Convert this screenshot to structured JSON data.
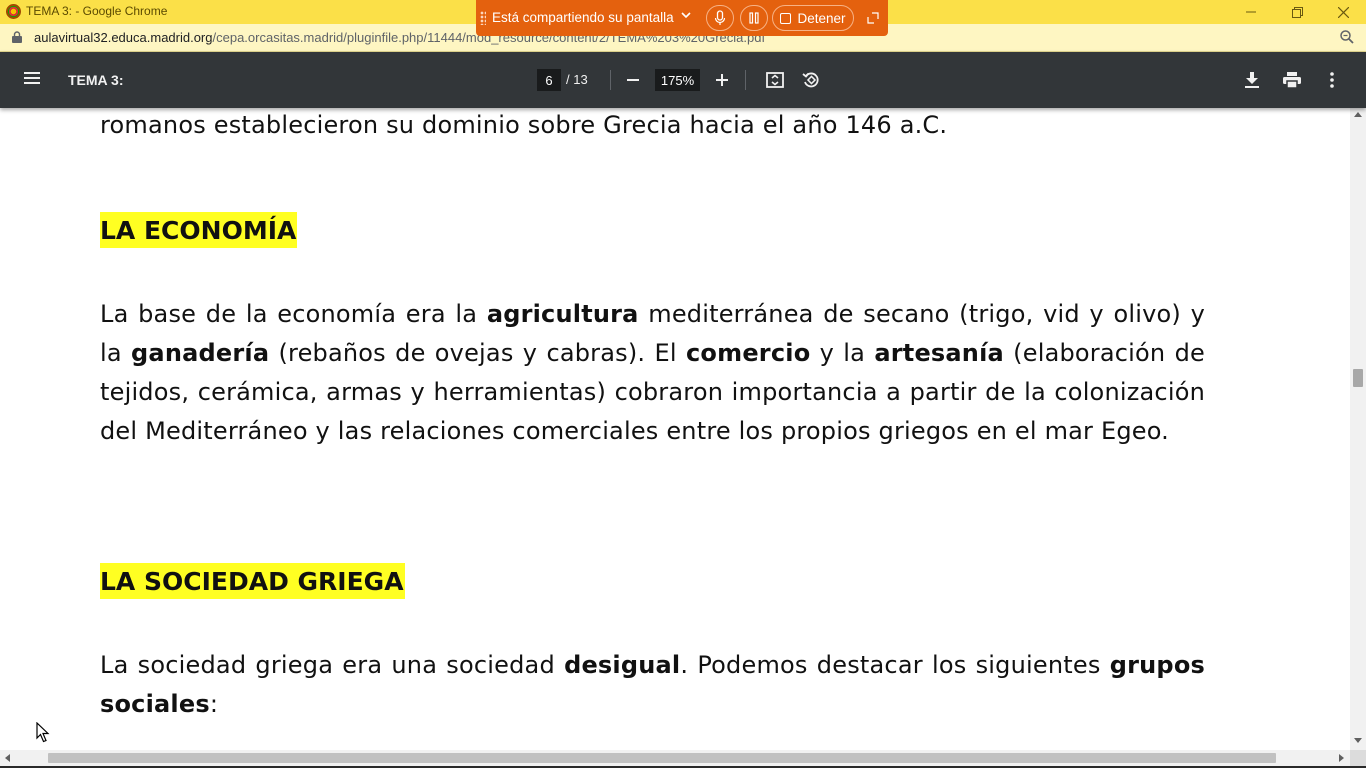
{
  "window": {
    "title": "TEMA 3: - Google Chrome",
    "minimize_icon": "minimize-icon",
    "restore_icon": "restore-icon",
    "close_icon": "close-icon",
    "title_bar_color": "#fbe048"
  },
  "share_banner": {
    "text": "Está compartiendo su pantalla",
    "stop_label": "Detener",
    "color": "#e4610e"
  },
  "address_bar": {
    "host": "aulavirtual32.educa.madrid.org",
    "path": "/cepa.orcasitas.madrid/pluginfile.php/11444/mod_resource/content/2/TEMA%203%20Grecia.pdf"
  },
  "pdf_toolbar": {
    "title": "TEMA 3:",
    "current_page": "6",
    "page_total": "/ 13",
    "zoom": "175%"
  },
  "document": {
    "intro_line": "romanos establecieron su dominio sobre Grecia hacia el año 146 a.C.",
    "economy_heading": "LA ECONOMÍA",
    "economy_paragraph": {
      "t1": "La base de la economía era la ",
      "b1": "agricultura",
      "t2": " mediterránea de secano (trigo, vid y olivo) y la ",
      "b2": "ganadería",
      "t3": " (rebaños de ovejas y cabras). El ",
      "b3": "comercio",
      "t4": " y la ",
      "b4": "artesanía",
      "t5": " (elaboración de tejidos, cerámica, armas y herramientas) cobraron importancia a partir de la colonización del Mediterráneo y las relaciones comerciales entre los propios griegos en el mar Egeo."
    },
    "society_heading": "LA SOCIEDAD GRIEGA",
    "society_paragraph": {
      "t1": "La sociedad griega era una sociedad ",
      "b1": "desigual",
      "t2": ". Podemos destacar los siguientes ",
      "b2": "grupos sociales",
      "t3": ":"
    },
    "highlight_color": "#ffff22"
  }
}
